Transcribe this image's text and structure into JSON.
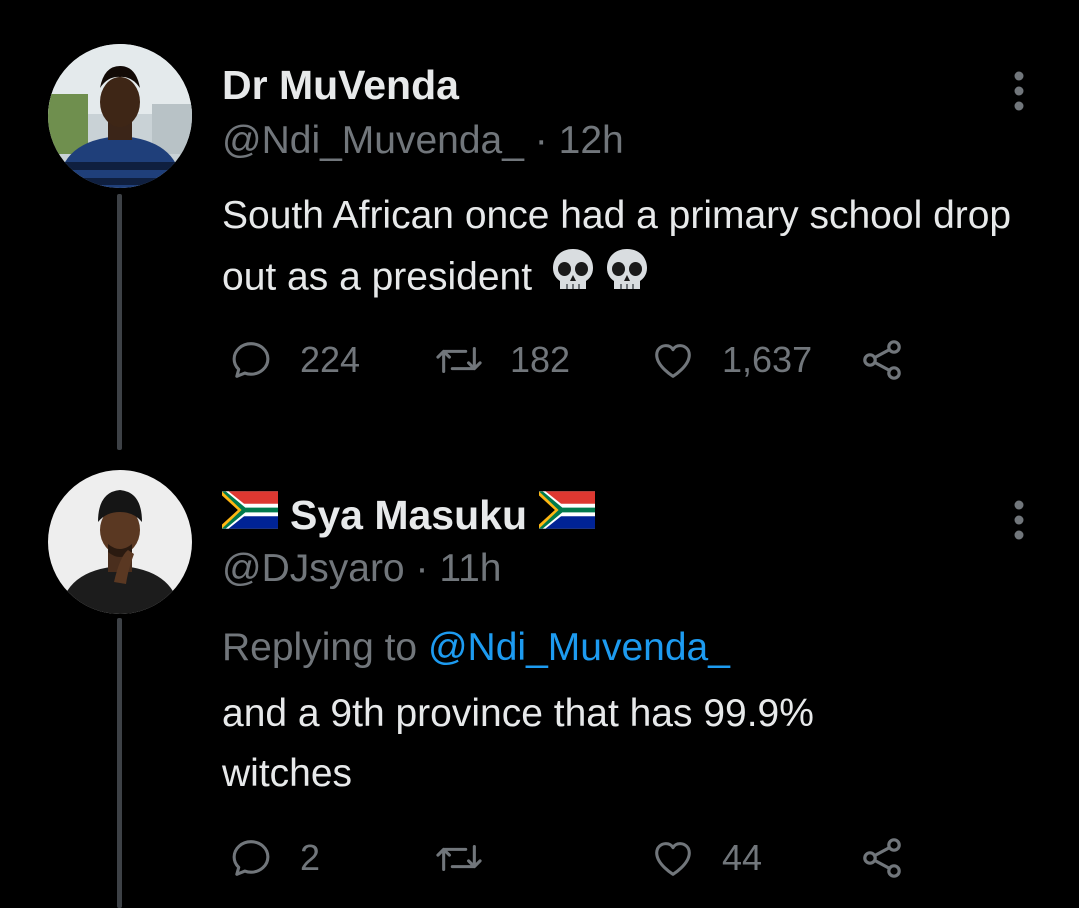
{
  "tweets": [
    {
      "display_name": "Dr MuVenda",
      "handle": "@Ndi_Muvenda_",
      "separator": "·",
      "time": "12h",
      "text": "South African once had a primary school drop out as a president",
      "emojis": [
        "skull",
        "skull"
      ],
      "actions": {
        "reply_count": "224",
        "retweet_count": "182",
        "like_count": "1,637"
      }
    },
    {
      "display_name": "Sya Masuku",
      "name_flags": [
        "south-africa-flag",
        "south-africa-flag"
      ],
      "handle": "@DJsyaro",
      "separator": "·",
      "time": "11h",
      "replying_label": "Replying to",
      "replying_to": "@Ndi_Muvenda_",
      "text": "and a 9th province that has 99.9% witches",
      "actions": {
        "reply_count": "2",
        "retweet_count": "",
        "like_count": "44"
      }
    }
  ],
  "colors": {
    "background": "#000000",
    "text_primary": "#e7e9ea",
    "text_secondary": "#71767b",
    "link": "#1d9bf0",
    "thread_line": "#3d4146"
  }
}
